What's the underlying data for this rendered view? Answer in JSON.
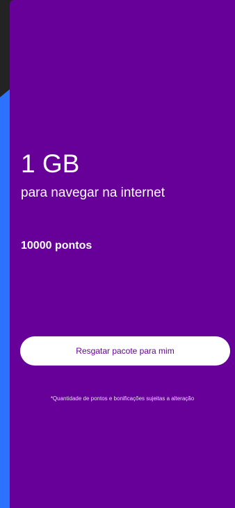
{
  "offer": {
    "data_amount": "1 GB",
    "description": "para navegar na internet",
    "points": "10000 pontos",
    "redeem_button_label": "Resgatar pacote para mim",
    "disclaimer": "*Quantidade de pontos e bonificações sujeitas a alteração"
  },
  "colors": {
    "card_background": "#660099",
    "side_background": "#2d72ff",
    "corner_background": "#232323",
    "button_background": "#ffffff",
    "button_text": "#660099",
    "text": "#ffffff"
  }
}
